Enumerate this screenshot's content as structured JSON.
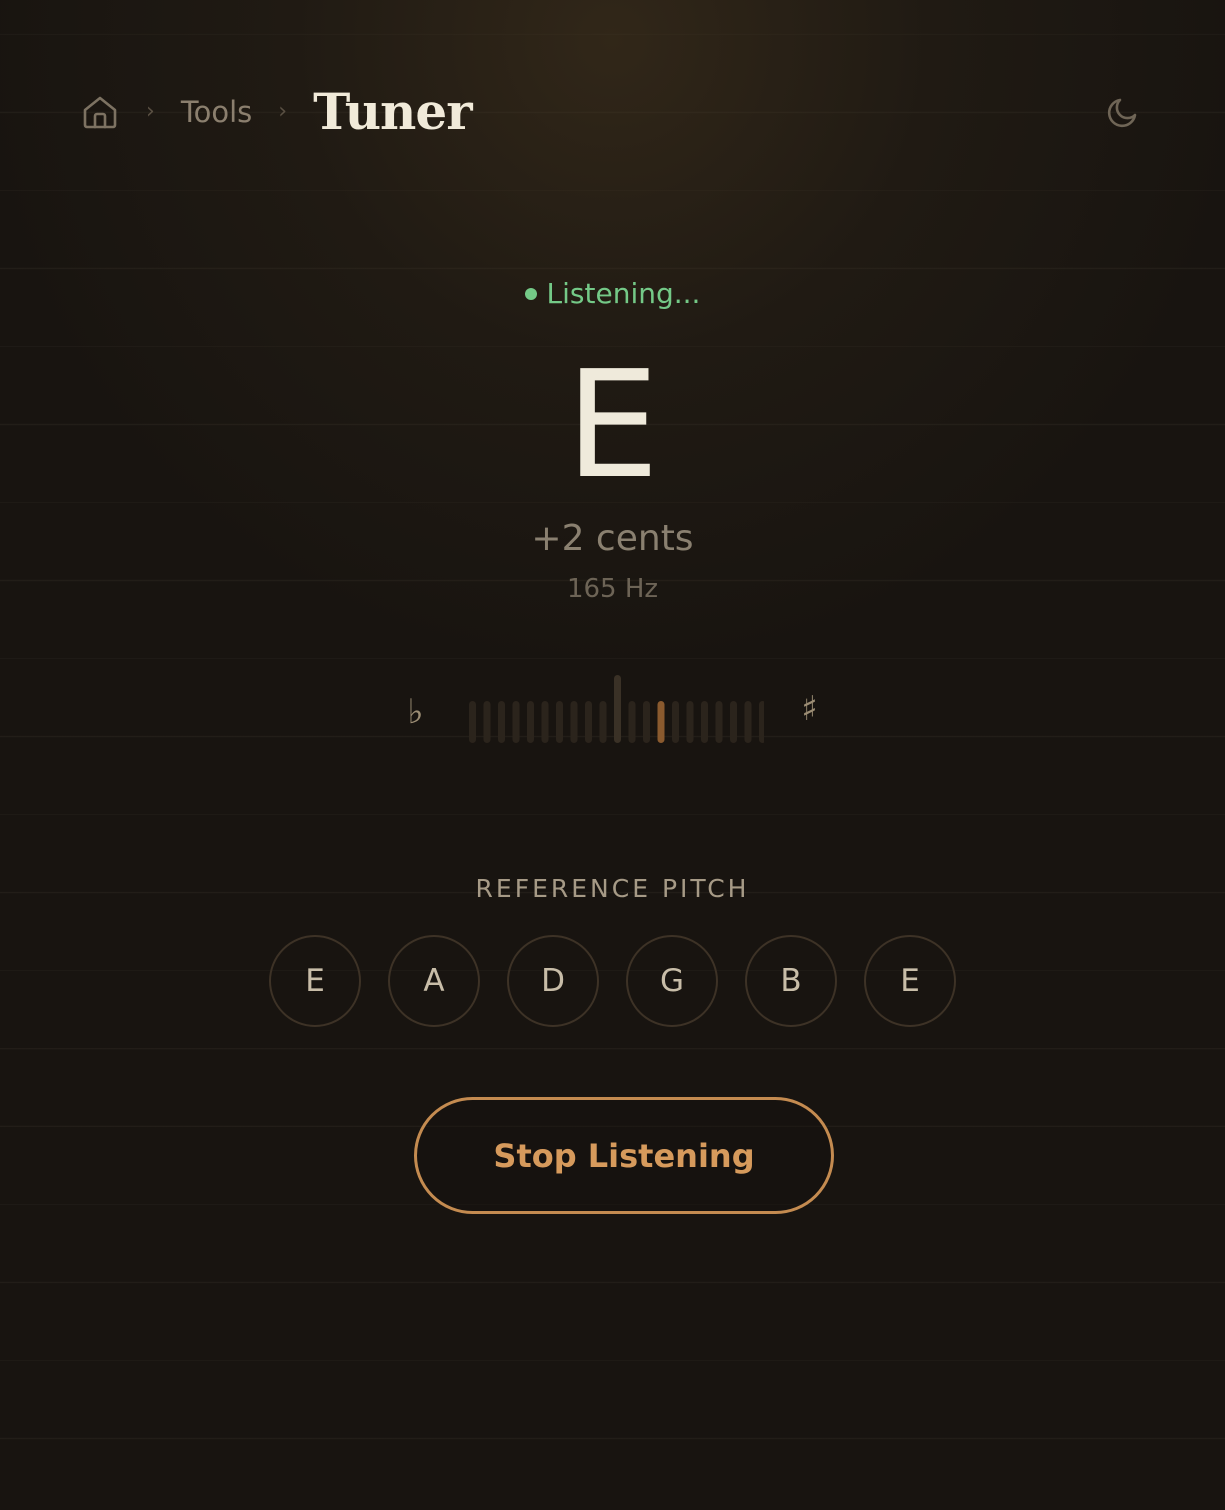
{
  "breadcrumb": {
    "home_icon": "home-icon",
    "tools_label": "Tools",
    "separator": "›"
  },
  "header": {
    "title": "Tuner",
    "theme_icon": "moon-icon"
  },
  "status": {
    "text": "Listening...",
    "color": "#74c987"
  },
  "reading": {
    "note": "E",
    "cents_text": "+2 cents",
    "frequency_text": "165 Hz"
  },
  "meter": {
    "flat_symbol": "♭",
    "sharp_symbol": "♯",
    "tick_count": 21,
    "active_offset_from_center": 3,
    "accent_color": "#8a5a2e"
  },
  "reference": {
    "label": "REFERENCE PITCH",
    "strings": [
      "E",
      "A",
      "D",
      "G",
      "B",
      "E"
    ]
  },
  "actions": {
    "stop_label": "Stop Listening",
    "accent": "#c48b50"
  }
}
